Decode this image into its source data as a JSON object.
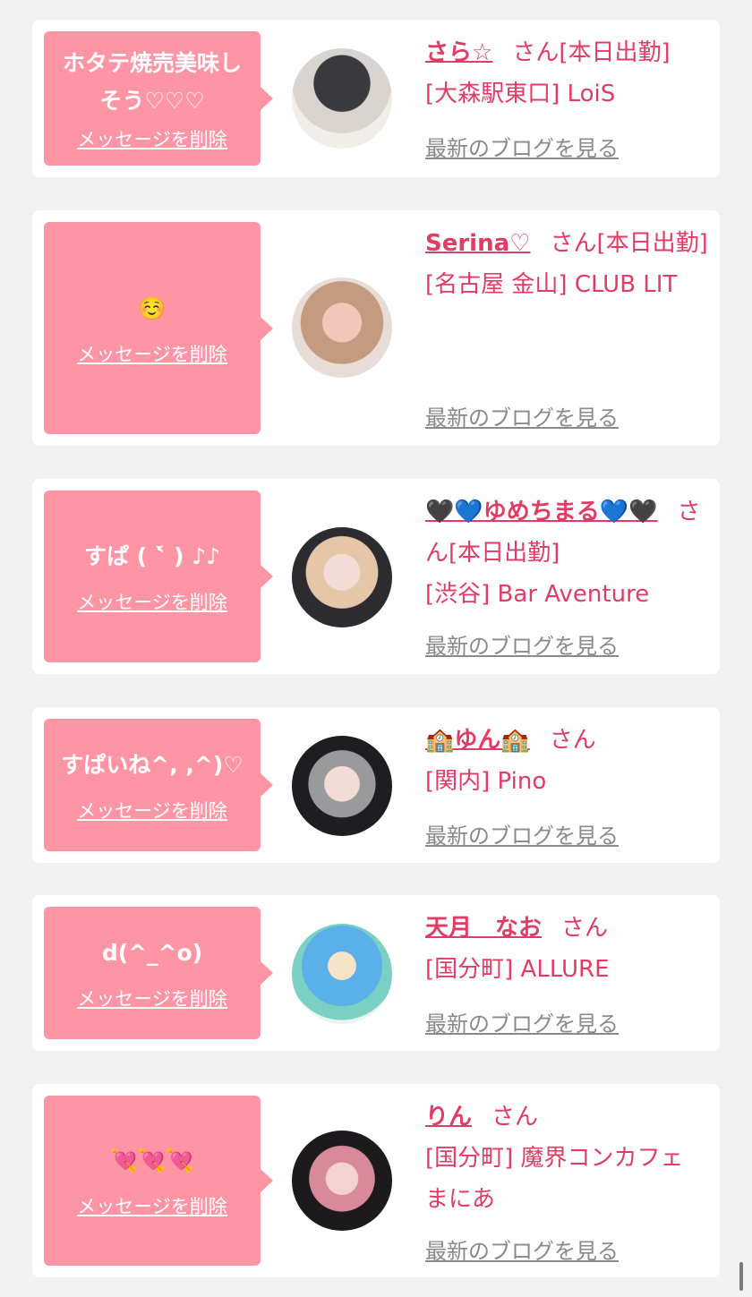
{
  "delete_label": "メッセージを削除",
  "blog_label": "最新のブログを見る",
  "san_suffix": "さん",
  "colors": {
    "accent": "#e23c64",
    "bubble": "#fe95a5",
    "muted": "#8a8a8a",
    "background": "#f2f2f3"
  },
  "cards": [
    {
      "message": "ホタテ焼売美味しそう♡♡♡",
      "name": "さら☆",
      "status": "[本日出勤]",
      "shop": "[大森駅東口] LoiS"
    },
    {
      "message": "☺️",
      "name": "Serina♡",
      "status": "[本日出勤]",
      "shop": "[名古屋 金山] CLUB LIT"
    },
    {
      "message": "すぱ ( ˂̀ ) ♪♪",
      "name": "🖤💙ゆめちまる💙🖤",
      "status": "[本日出勤]",
      "shop": "[渋谷] Bar Aventure"
    },
    {
      "message": "すぱいね^, ,^)♡",
      "name": "🏫ゆん🏫",
      "status": "",
      "shop": "[関内] Pino"
    },
    {
      "message": "d(^_^o)",
      "name": "天月　なお",
      "status": "",
      "shop": "[国分町] ALLURE"
    },
    {
      "message": "💘💘💘",
      "name": "りん",
      "status": "",
      "shop": "[国分町] 魔界コンカフェ まにあ"
    }
  ]
}
